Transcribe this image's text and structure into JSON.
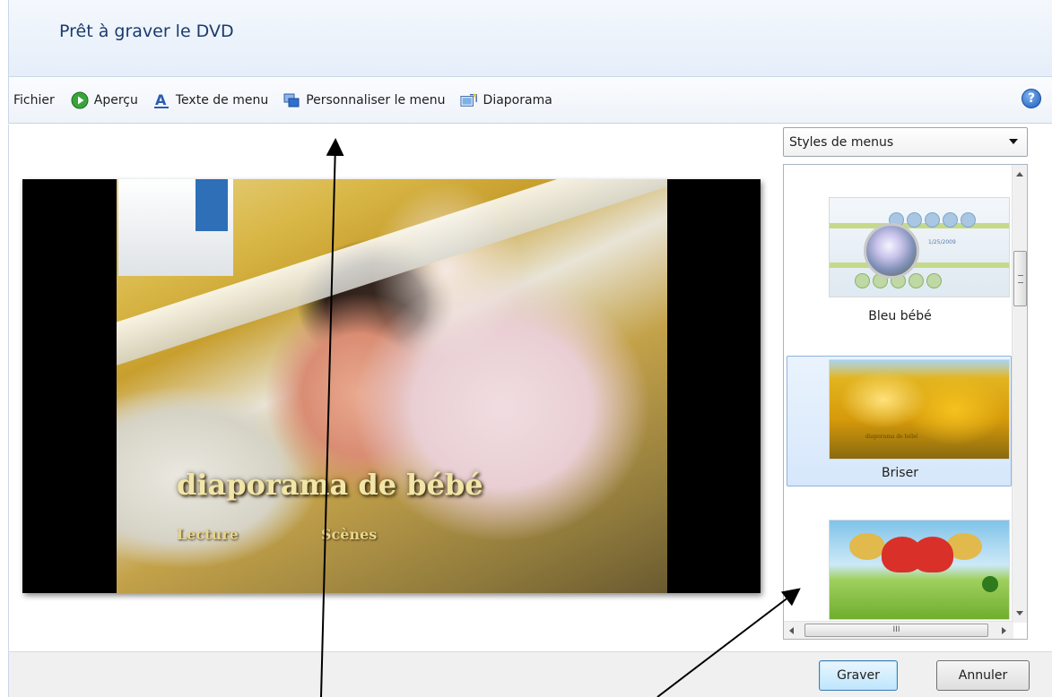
{
  "header": {
    "title": "Prêt à graver le DVD"
  },
  "toolbar": {
    "file_label": "Fichier",
    "preview_label": "Aperçu",
    "menu_text_label": "Texte de menu",
    "customize_menu_label": "Personnaliser le menu",
    "slideshow_label": "Diaporama",
    "help_glyph": "?"
  },
  "preview": {
    "menu_title": "diaporama de bébé",
    "play_label": "Lecture",
    "scenes_label": "Scènes"
  },
  "styles_panel": {
    "dropdown_value": "Styles de menus",
    "items": [
      {
        "label": "Bleu bébé",
        "thumb_text": "1/25/2009",
        "selected": false
      },
      {
        "label": "Briser",
        "thumb_text": "diaporama de bébé",
        "selected": true
      },
      {
        "label": "",
        "thumb_text": "",
        "selected": false
      }
    ],
    "hscroll_glyph": "III"
  },
  "buttons": {
    "burn_label": "Graver",
    "cancel_label": "Annuler"
  },
  "colors": {
    "header_text": "#1b3b6d",
    "selection": "#d6e7fb",
    "accent_border": "#3c7fb1"
  },
  "icons": {
    "preview": "play-circle-icon",
    "menu_text": "text-a-icon",
    "customize_menu": "palette-icon",
    "slideshow": "slideshow-icon",
    "help": "help-icon"
  }
}
